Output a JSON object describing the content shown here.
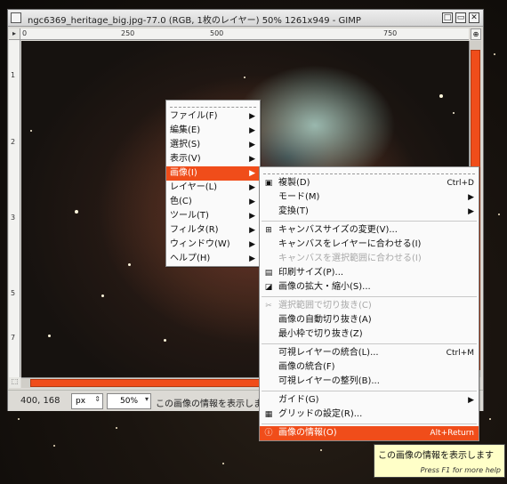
{
  "window": {
    "title": "ngc6369_heritage_big.jpg-77.0 (RGB, 1枚のレイヤー) 50% 1261x949 - GIMP",
    "controls": [
      "□",
      "▭",
      "✕"
    ]
  },
  "rulers": {
    "top_labels": [
      "0",
      "250",
      "500",
      "750"
    ],
    "left_labels": [
      "1",
      "2",
      "3",
      "5",
      "7"
    ]
  },
  "status": {
    "coords": "400, 168",
    "unit": "px",
    "zoom": "50%",
    "message": "この画像の情報を表示しま"
  },
  "main_menu": {
    "items": [
      {
        "label": "ファイル(F)"
      },
      {
        "label": "編集(E)"
      },
      {
        "label": "選択(S)"
      },
      {
        "label": "表示(V)"
      },
      {
        "label": "画像(I)",
        "selected": true
      },
      {
        "label": "レイヤー(L)"
      },
      {
        "label": "色(C)"
      },
      {
        "label": "ツール(T)"
      },
      {
        "label": "フィルタ(R)"
      },
      {
        "label": "ウィンドウ(W)"
      },
      {
        "label": "ヘルプ(H)"
      }
    ]
  },
  "image_menu": {
    "groups": [
      [
        {
          "label": "複製(D)",
          "accel": "Ctrl+D",
          "icon": "duplicate-icon"
        },
        {
          "label": "モード(M)",
          "submenu": true
        },
        {
          "label": "変換(T)",
          "submenu": true
        }
      ],
      [
        {
          "label": "キャンバスサイズの変更(V)...",
          "icon": "canvas-size-icon"
        },
        {
          "label": "キャンバスをレイヤーに合わせる(I)"
        },
        {
          "label": "キャンバスを選択範囲に合わせる(I)",
          "disabled": true
        },
        {
          "label": "印刷サイズ(P)...",
          "icon": "print-size-icon"
        },
        {
          "label": "画像の拡大・縮小(S)...",
          "icon": "scale-image-icon"
        }
      ],
      [
        {
          "label": "選択範囲で切り抜き(C)",
          "disabled": true,
          "icon": "crop-icon"
        },
        {
          "label": "画像の自動切り抜き(A)"
        },
        {
          "label": "最小枠で切り抜き(Z)"
        }
      ],
      [
        {
          "label": "可視レイヤーの統合(L)...",
          "accel": "Ctrl+M"
        },
        {
          "label": "画像の統合(F)"
        },
        {
          "label": "可視レイヤーの整列(B)..."
        }
      ],
      [
        {
          "label": "ガイド(G)",
          "submenu": true
        },
        {
          "label": "グリッドの設定(R)...",
          "icon": "grid-icon"
        }
      ],
      [
        {
          "label": "画像の情報(O)",
          "accel": "Alt+Return",
          "selected": true,
          "icon": "info-icon"
        }
      ]
    ]
  },
  "tooltip": {
    "text": "この画像の情報を表示します",
    "help": "Press F1 for more help"
  }
}
